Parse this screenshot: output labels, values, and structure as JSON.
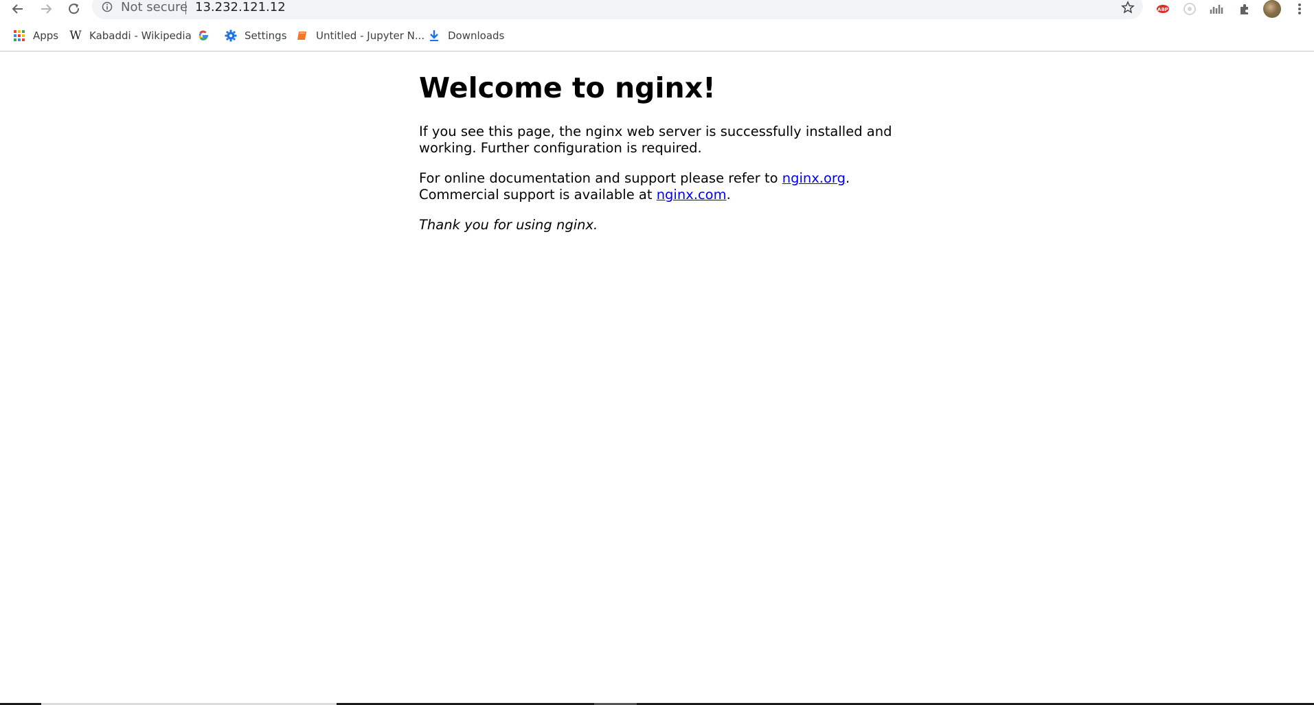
{
  "toolbar": {
    "security_label": "Not secure",
    "url": "13.232.121.12"
  },
  "bookmarks": [
    {
      "label": "Apps",
      "icon": "apps-grid-icon"
    },
    {
      "label": "Kabaddi - Wikipedia",
      "icon": "wikipedia-icon"
    },
    {
      "label": "",
      "icon": "google-icon"
    },
    {
      "label": "Settings",
      "icon": "gear-icon"
    },
    {
      "label": "Untitled - Jupyter N...",
      "icon": "jupyter-book-icon"
    },
    {
      "label": "Downloads",
      "icon": "download-icon"
    }
  ],
  "page": {
    "title": "Welcome to nginx!",
    "para1": "If you see this page, the nginx web server is successfully installed and working. Further configuration is required.",
    "para2_pre": "For online documentation and support please refer to ",
    "para2_link": "nginx.org",
    "para2_mid": ".",
    "para2_line2": "Commercial support is available at ",
    "para2_link2": "nginx.com",
    "para2_end": ".",
    "para3": "Thank you for using nginx."
  },
  "colors": {
    "link": "#0000ee",
    "omnibox_bg": "#f1f3f4",
    "toolbar_icon": "#5f6368"
  }
}
